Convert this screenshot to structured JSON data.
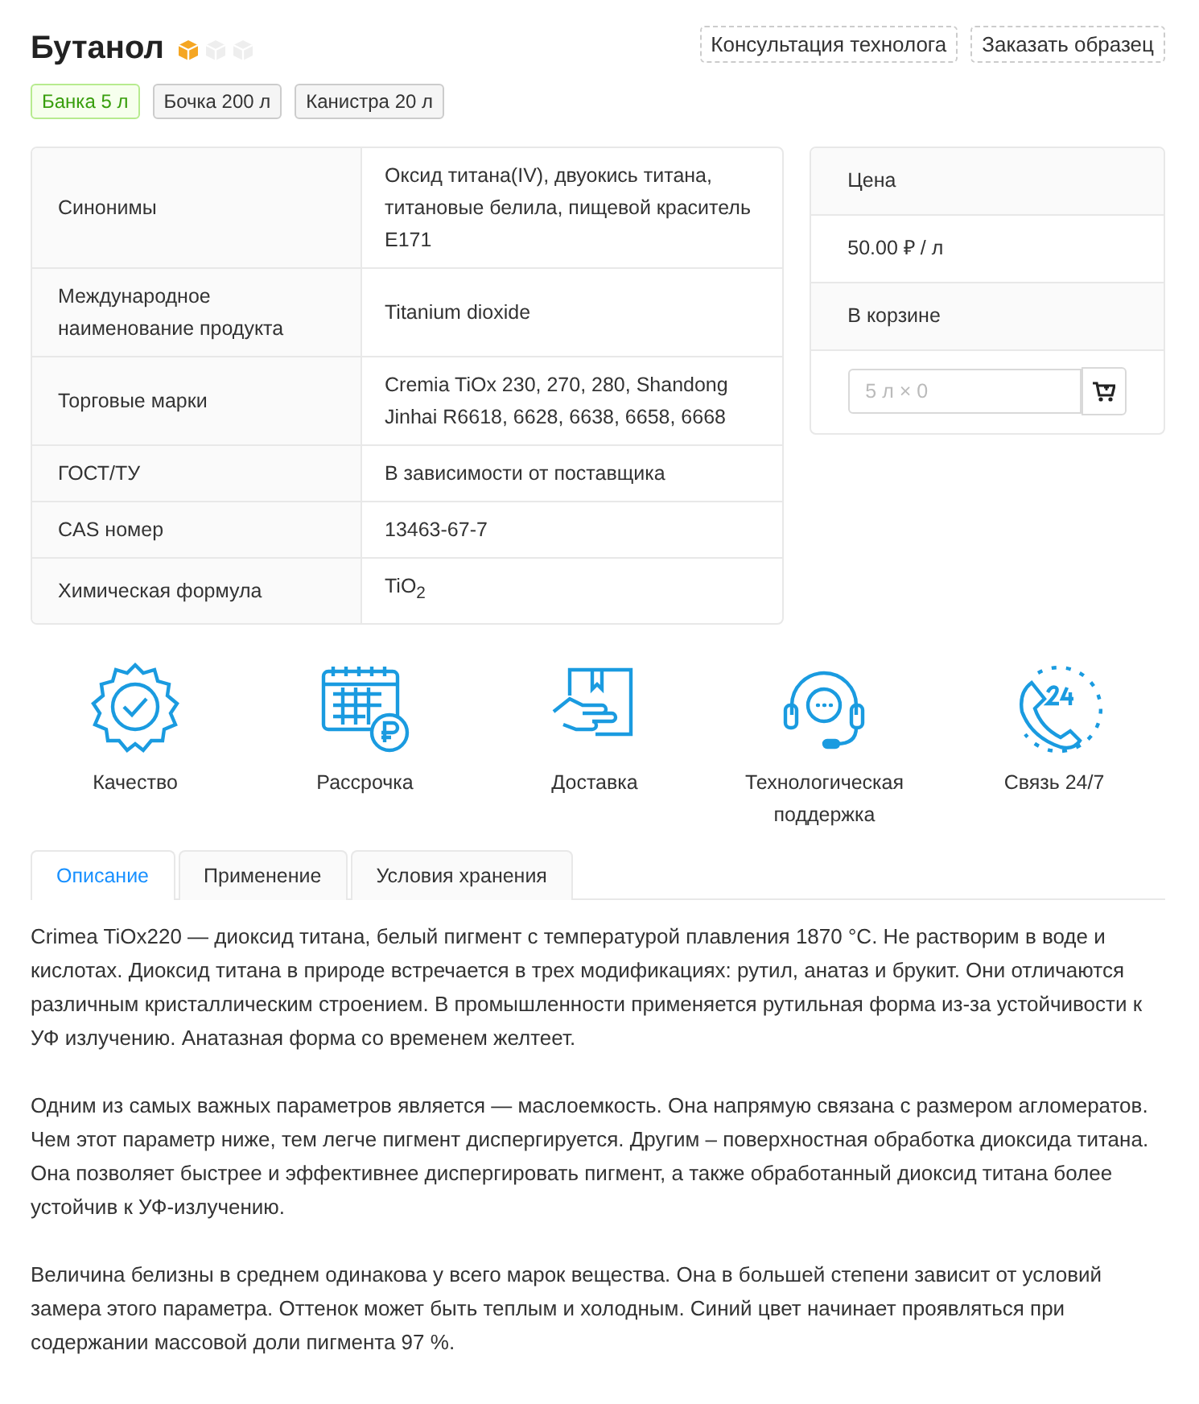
{
  "product": {
    "title": "Бутанол",
    "rating_cubes": [
      {
        "filled": true
      },
      {
        "filled": false
      },
      {
        "filled": false
      }
    ]
  },
  "actions": [
    "Консультация технолога",
    "Заказать образец"
  ],
  "packages": [
    {
      "label": "Банка 5 л",
      "selected": true
    },
    {
      "label": "Бочка 200 л",
      "selected": false
    },
    {
      "label": "Канистра 20 л",
      "selected": false
    }
  ],
  "specs": [
    {
      "label": "Синонимы",
      "value": "Оксид титана(IV), двуокись титана, титановые белила, пищевой краситель E171"
    },
    {
      "label": "Международное наименование продукта",
      "value": "Titanium dioxide"
    },
    {
      "label": "Торговые марки",
      "value": "Cremia TiOx 230, 270, 280, Shandong Jinhai R6618, 6628, 6638, 6658, 6668"
    },
    {
      "label": "ГОСТ/ТУ",
      "value": "В зависимости от поставщика"
    },
    {
      "label": "CAS номер",
      "value": "13463-67-7"
    },
    {
      "label": "Химическая формула",
      "value": "TiO$_{2}$"
    }
  ],
  "price_card": {
    "price_label": "Цена",
    "price": "50.00 ₽ / л",
    "cart_label": "В корзине",
    "quantity_placeholder": "5 л × 0"
  },
  "features": [
    {
      "kind": "quality",
      "label": "Качество"
    },
    {
      "kind": "installment",
      "label": "Рассрочка"
    },
    {
      "kind": "delivery",
      "label": "Доставка"
    },
    {
      "kind": "support",
      "label": "Технологическая поддержка"
    },
    {
      "kind": "phone",
      "label": "Связь 24/7"
    }
  ],
  "tabs": [
    {
      "label": "Описание",
      "selected": true
    },
    {
      "label": "Применение",
      "selected": false
    },
    {
      "label": "Условия хранения",
      "selected": false
    }
  ],
  "description": [
    "Crimea TiOx220 — диоксид титана, белый пигмент с температурой плавления 1870 °C. Не растворим в воде и кислотах. Диоксид титана в природе встречается в трех модификациях: рутил, анатаз и брукит. Они отличаются различным кристаллическим строением. В промышленности применяется рутильная форма из-за устойчивости к УФ излучению. Анатазная форма со временем желтеет.",
    "Одним из самых важных параметров является — маслоемкость. Она напрямую связана с размером агломератов. Чем этот параметр ниже, тем легче пигмент диспергируется. Другим – поверхностная обработка диоксида титана. Она позволяет быстрее и эффективнее диспергировать пигмент, а также обработанный диоксид титана более устойчив к УФ-излучению.",
    "Величина белизны в среднем одинакова у всего марок вещества. Она в большей степени зависит от условий замера этого параметра. Оттенок может быть теплым и холодным. Синий цвет начинает проявляться при содержании массовой доли пигмента 97 %."
  ]
}
